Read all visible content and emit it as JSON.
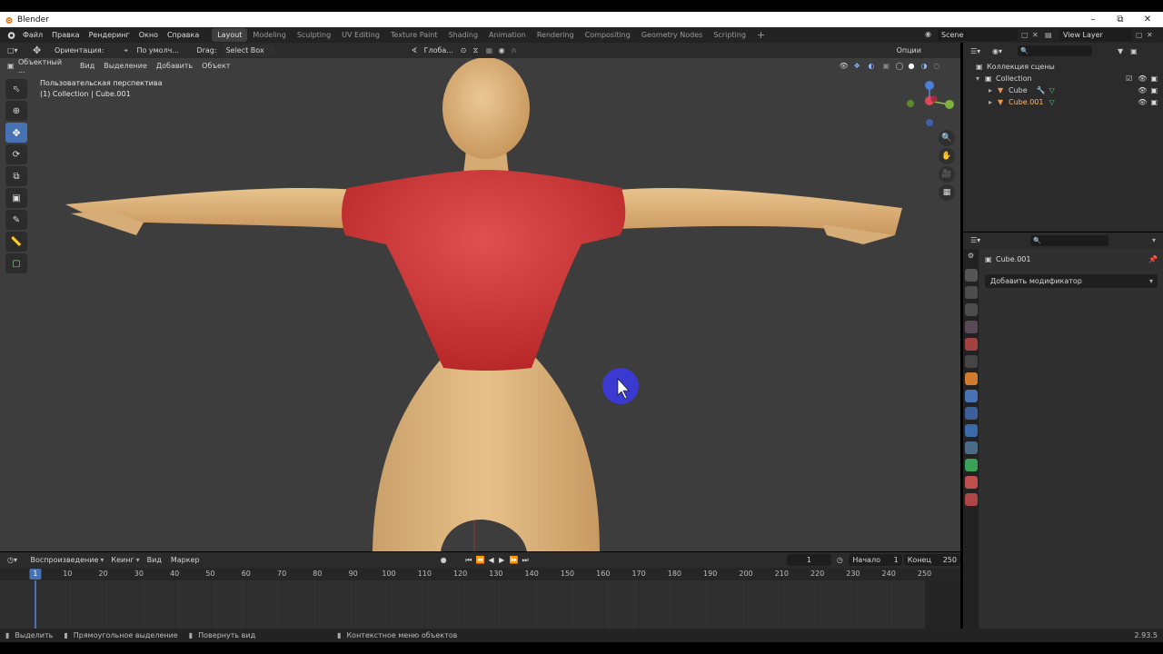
{
  "window": {
    "title": "Blender",
    "minimize": "–",
    "maximize": "⧉",
    "close": "✕"
  },
  "menu": {
    "items": [
      "Файл",
      "Правка",
      "Рендеринг",
      "Окно",
      "Справка"
    ]
  },
  "workspaces": {
    "tabs": [
      "Layout",
      "Modeling",
      "Sculpting",
      "UV Editing",
      "Texture Paint",
      "Shading",
      "Animation",
      "Rendering",
      "Compositing",
      "Geometry Nodes",
      "Scripting"
    ],
    "active": "Layout",
    "add": "+"
  },
  "scene": {
    "name": "Scene",
    "view_layer": "View Layer"
  },
  "viewport_header": {
    "orientation_label": "Ориентация:",
    "orientation_value": "По умолч...",
    "drag_label": "Drag:",
    "drag_value": "Select Box",
    "transform_space": "Глоба...",
    "options": "Опции"
  },
  "viewport_menu": {
    "mode": "Объектный ...",
    "items": [
      "Вид",
      "Выделение",
      "Добавить",
      "Объект"
    ]
  },
  "viewport_overlay": {
    "perspective": "Пользовательская перспектива",
    "collection": "(1) Collection | Cube.001"
  },
  "gizmo": {
    "z": "Z",
    "x": "X",
    "y": "Y"
  },
  "timeline": {
    "menu": [
      "Воспроизведение",
      "Кеинг",
      "Вид",
      "Маркер"
    ],
    "current_frame": "1",
    "start_label": "Начало",
    "start_value": "1",
    "end_label": "Конец",
    "end_value": "250",
    "ruler": [
      "1",
      "10",
      "20",
      "30",
      "40",
      "50",
      "60",
      "70",
      "80",
      "90",
      "100",
      "110",
      "120",
      "130",
      "140",
      "150",
      "160",
      "170",
      "180",
      "190",
      "200",
      "210",
      "220",
      "230",
      "240",
      "250"
    ]
  },
  "statusbar": {
    "select": "Выделить",
    "box_select": "Прямоугольное выделение",
    "rotate": "Повернуть вид",
    "context": "Контекстное меню объектов",
    "version": "2.93.5"
  },
  "outliner": {
    "root": "Коллекция сцены",
    "collection": "Collection",
    "objects": [
      "Cube",
      "Cube.001"
    ]
  },
  "properties": {
    "object_name": "Cube.001",
    "add_modifier": "Добавить модификатор"
  },
  "colors": {
    "skin": "#dcb27a",
    "shirt": "#d43a3a",
    "accent": "#4772b3",
    "cursor_circle": "#3a3ad0"
  }
}
